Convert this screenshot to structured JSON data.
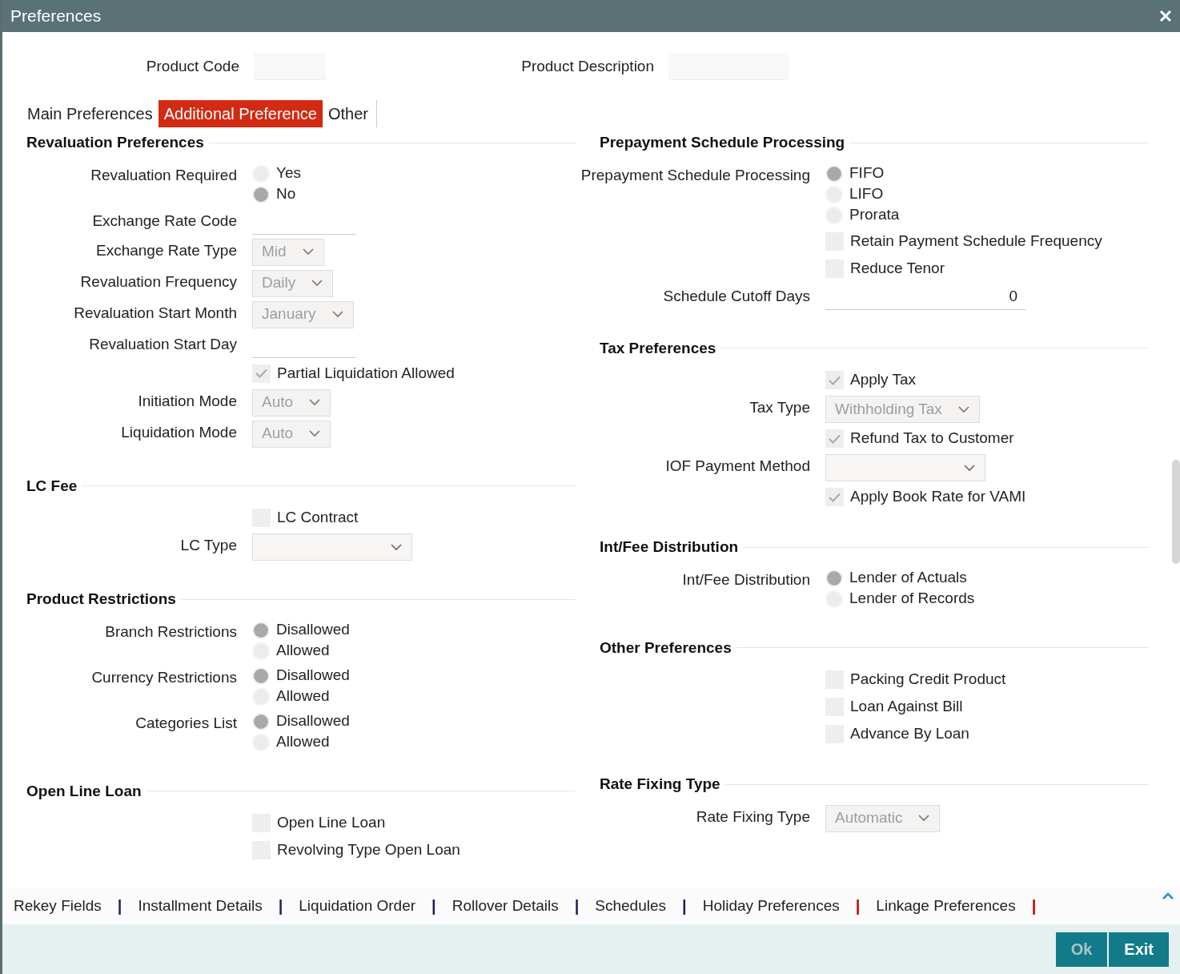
{
  "window": {
    "title": "Preferences"
  },
  "header_fields": [
    {
      "label": "Product Code"
    },
    {
      "label": "Product Description"
    }
  ],
  "tabs": [
    {
      "label": "Main Preferences",
      "selected": false
    },
    {
      "label": "Additional Preference",
      "selected": true
    },
    {
      "label": "Other",
      "selected": false
    }
  ],
  "columns": [
    [
      {
        "title": "Revaluation Preferences",
        "rows": [
          {
            "kind": "radio",
            "label": "Revaluation Required",
            "options": [
              {
                "label": "Yes",
                "selected": false
              },
              {
                "label": "No",
                "selected": true
              }
            ]
          },
          {
            "kind": "text",
            "label": "Exchange Rate Code"
          },
          {
            "kind": "select",
            "label": "Exchange Rate Type",
            "value": "Mid",
            "disabled": true
          },
          {
            "kind": "select",
            "label": "Revaluation Frequency",
            "value": "Daily",
            "disabled": true
          },
          {
            "kind": "select",
            "label": "Revaluation Start Month",
            "value": "January",
            "disabled": true
          },
          {
            "kind": "text",
            "label": "Revaluation Start Day"
          },
          {
            "kind": "check",
            "text": "Partial Liquidation Allowed",
            "checked": true
          },
          {
            "kind": "select",
            "label": "Initiation Mode",
            "value": "Auto",
            "disabled": true
          },
          {
            "kind": "select",
            "label": "Liquidation Mode",
            "value": "Auto",
            "disabled": true
          }
        ]
      },
      {
        "title": "LC Fee",
        "rows": [
          {
            "kind": "check",
            "text": "LC Contract",
            "checked": false
          },
          {
            "kind": "select",
            "label": "LC Type",
            "disabled": false
          }
        ]
      },
      {
        "title": "Product Restrictions",
        "rows": [
          {
            "kind": "radio",
            "label": "Branch Restrictions",
            "options": [
              {
                "label": "Disallowed",
                "selected": true
              },
              {
                "label": "Allowed",
                "selected": false
              }
            ]
          },
          {
            "kind": "radio",
            "label": "Currency Restrictions",
            "options": [
              {
                "label": "Disallowed",
                "selected": true
              },
              {
                "label": "Allowed",
                "selected": false
              }
            ]
          },
          {
            "kind": "radio",
            "label": "Categories List",
            "options": [
              {
                "label": "Disallowed",
                "selected": true
              },
              {
                "label": "Allowed",
                "selected": false
              }
            ]
          }
        ]
      },
      {
        "title": "Open Line Loan",
        "rows": [
          {
            "kind": "check",
            "text": "Open Line Loan",
            "checked": false
          },
          {
            "kind": "check",
            "text": "Revolving Type Open Loan",
            "checked": false
          }
        ]
      }
    ],
    [
      {
        "title": "Prepayment Schedule Processing",
        "rows": [
          {
            "kind": "radio",
            "label": "Prepayment Schedule Processing",
            "options": [
              {
                "label": "FIFO",
                "selected": true
              },
              {
                "label": "LIFO",
                "selected": false
              },
              {
                "label": "Prorata",
                "selected": false
              }
            ]
          },
          {
            "kind": "check",
            "text": "Retain Payment Schedule Frequency",
            "checked": false
          },
          {
            "kind": "check",
            "text": "Reduce Tenor",
            "checked": false
          },
          {
            "kind": "text",
            "label": "Schedule Cutoff Days",
            "value": "0"
          }
        ]
      },
      {
        "title": "Tax Preferences",
        "rows": [
          {
            "kind": "check",
            "text": "Apply Tax",
            "checked": true
          },
          {
            "kind": "select",
            "label": "Tax Type",
            "value": "Withholding Tax",
            "disabled": true
          },
          {
            "kind": "check",
            "text": "Refund Tax to Customer",
            "checked": true
          },
          {
            "kind": "select",
            "label": "IOF Payment Method",
            "disabled": false
          },
          {
            "kind": "check",
            "text": "Apply Book Rate for VAMI",
            "checked": true
          }
        ]
      },
      {
        "title": "Int/Fee Distribution",
        "rows": [
          {
            "kind": "radio",
            "label": "Int/Fee Distribution",
            "options": [
              {
                "label": "Lender of Actuals",
                "selected": true
              },
              {
                "label": "Lender of Records",
                "selected": false
              }
            ]
          }
        ]
      },
      {
        "title": "Other Preferences",
        "rows": [
          {
            "kind": "check",
            "text": "Packing Credit Product",
            "checked": false
          },
          {
            "kind": "check",
            "text": "Loan Against Bill",
            "checked": false
          },
          {
            "kind": "check",
            "text": "Advance By Loan",
            "checked": false
          }
        ]
      },
      {
        "title": "Rate Fixing Type",
        "rows": [
          {
            "kind": "select",
            "label": "Rate Fixing Type",
            "value": "Automatic",
            "disabled": true
          }
        ]
      }
    ]
  ],
  "footer_links": [
    {
      "label": "Rekey Fields",
      "separator": "|",
      "color": "#1f1f5c"
    },
    {
      "label": "Installment Details",
      "separator": "|",
      "color": "#1f1f5c"
    },
    {
      "label": "Liquidation Order",
      "separator": "|",
      "color": "#1f1f5c"
    },
    {
      "label": "Rollover Details",
      "separator": "|",
      "color": "#1f1f5c"
    },
    {
      "label": "Schedules",
      "separator": "|",
      "color": "#1f1f5c"
    },
    {
      "label": "Holiday Preferences",
      "separator": "|",
      "color": "#cc0000"
    },
    {
      "label": "Linkage Preferences",
      "separator": "|",
      "color": "#cc0000"
    }
  ],
  "buttons": [
    {
      "label": "Ok",
      "disabled": true
    },
    {
      "label": "Exit",
      "disabled": false
    }
  ]
}
